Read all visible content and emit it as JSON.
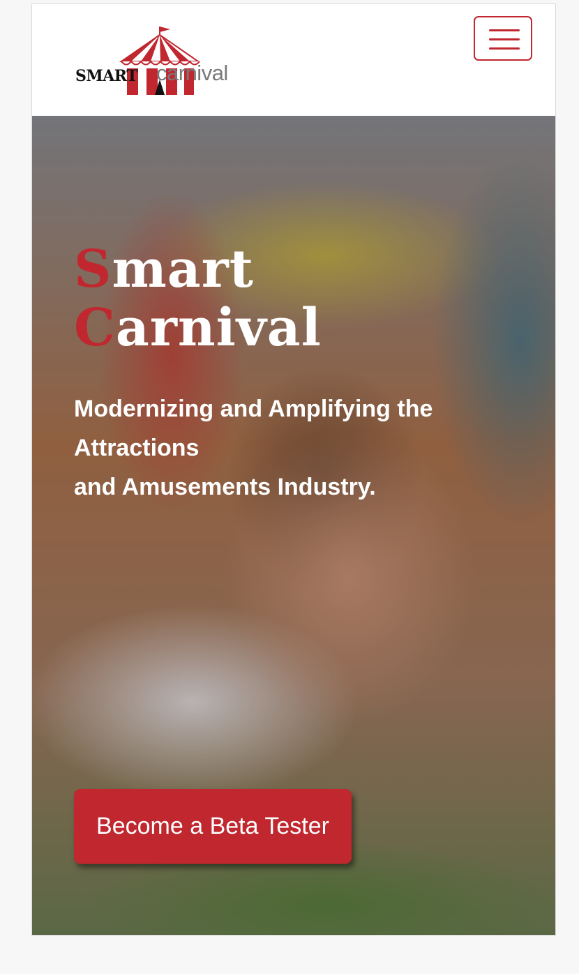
{
  "header": {
    "logo": {
      "smart": "SMART",
      "carnival": "carnival"
    },
    "menu_button_icon": "hamburger-menu-icon"
  },
  "hero": {
    "title_line1_first": "S",
    "title_line1_rest": "mart",
    "title_line2_first": "C",
    "title_line2_rest": "arnival",
    "subtitle_line1": "Modernizing and Amplifying the",
    "subtitle_line2": "Attractions",
    "subtitle_line3": "and Amusements Industry.",
    "cta_label": "Become a Beta Tester"
  },
  "colors": {
    "accent": "#c0272f",
    "logo_gray": "#7a7a7a",
    "text_light": "#ffffff"
  }
}
